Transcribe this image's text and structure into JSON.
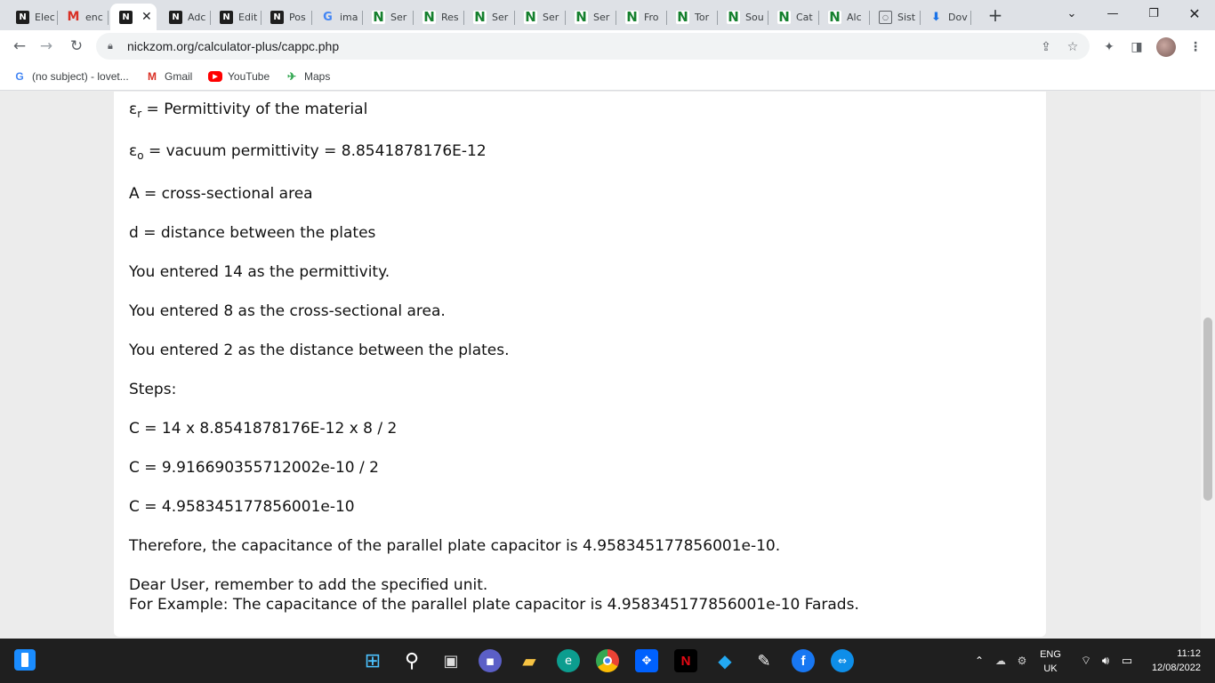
{
  "browser": {
    "tabs": [
      {
        "label": "Elec",
        "icon": "nickzom-icon"
      },
      {
        "label": "enc",
        "icon": "gmail-icon"
      },
      {
        "label": "",
        "icon": "nickzom-icon",
        "active": true
      },
      {
        "label": "Adc",
        "icon": "nickzom-icon"
      },
      {
        "label": "Edit",
        "icon": "nickzom-icon"
      },
      {
        "label": "Pos",
        "icon": "nickzom-icon"
      },
      {
        "label": "ima",
        "icon": "google-icon"
      },
      {
        "label": "Ser",
        "icon": "nickzom-n-icon"
      },
      {
        "label": "Res",
        "icon": "nickzom-n-icon"
      },
      {
        "label": "Ser",
        "icon": "nickzom-n-icon"
      },
      {
        "label": "Ser",
        "icon": "nickzom-n-icon"
      },
      {
        "label": "Ser",
        "icon": "nickzom-n-icon"
      },
      {
        "label": "Fro",
        "icon": "nickzom-n-icon"
      },
      {
        "label": "Tor",
        "icon": "nickzom-n-icon"
      },
      {
        "label": "Sou",
        "icon": "nickzom-n-icon"
      },
      {
        "label": "Cat",
        "icon": "nickzom-n-icon"
      },
      {
        "label": "Alc",
        "icon": "nickzom-n-icon"
      },
      {
        "label": "Sist",
        "icon": "search-icon"
      },
      {
        "label": "Dov",
        "icon": "download-icon"
      }
    ],
    "close_glyph": "✕",
    "new_tab_glyph": "+",
    "url": "nickzom.org/calculator-plus/cappc.php"
  },
  "bookmarks": [
    {
      "label": "(no subject) - lovet...",
      "icon": "google-icon"
    },
    {
      "label": "Gmail",
      "icon": "gmail-icon"
    },
    {
      "label": "YouTube",
      "icon": "youtube-icon"
    },
    {
      "label": "Maps",
      "icon": "maps-icon"
    }
  ],
  "content": {
    "er_symbol": "ε",
    "er_sub": "r",
    "er_text": " = Permittivity of the material",
    "eo_symbol": "ε",
    "eo_sub": "o",
    "eo_text": " = vacuum permittivity = 8.8541878176E-12",
    "area_def": "A = cross-sectional area",
    "dist_def": "d = distance between the plates",
    "entered_perm": "You entered 14 as the permittivity.",
    "entered_area": "You entered 8 as the cross-sectional area.",
    "entered_dist": "You entered 2 as the distance between the plates.",
    "steps_label": "Steps:",
    "step1": "C = 14 x 8.8541878176E-12 x 8 / 2",
    "step2": "C = 9.916690355712002e-10 / 2",
    "step3": "C = 4.958345177856001e-10",
    "therefore": "Therefore, the capacitance of the parallel plate capacitor is 4.958345177856001e-10.",
    "reminder": "Dear User, remember to add the specified unit.",
    "example": "For Example: The capacitance of the parallel plate capacitor is 4.958345177856001e-10 Farads."
  },
  "taskbar": {
    "lang_top": "ENG",
    "lang_bottom": "UK",
    "time": "11:12",
    "date": "12/08/2022"
  }
}
